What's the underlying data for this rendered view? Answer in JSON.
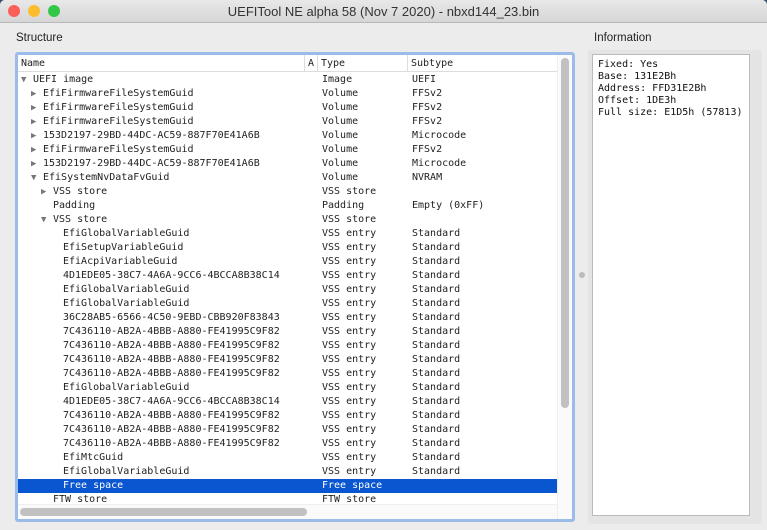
{
  "window": {
    "title": "UEFITool NE alpha 58 (Nov  7 2020) - nbxd144_23.bin"
  },
  "structure": {
    "label": "Structure",
    "columns": [
      "Name",
      "A",
      "Type",
      "Subtype"
    ],
    "rows": [
      {
        "name": "UEFI image",
        "type": "Image",
        "subtype": "UEFI",
        "depth": 0,
        "state": "expanded"
      },
      {
        "name": "EfiFirmwareFileSystemGuid",
        "type": "Volume",
        "subtype": "FFSv2",
        "depth": 1,
        "state": "collapsed"
      },
      {
        "name": "EfiFirmwareFileSystemGuid",
        "type": "Volume",
        "subtype": "FFSv2",
        "depth": 1,
        "state": "collapsed"
      },
      {
        "name": "EfiFirmwareFileSystemGuid",
        "type": "Volume",
        "subtype": "FFSv2",
        "depth": 1,
        "state": "collapsed"
      },
      {
        "name": "153D2197-29BD-44DC-AC59-887F70E41A6B",
        "type": "Volume",
        "subtype": "Microcode",
        "depth": 1,
        "state": "collapsed"
      },
      {
        "name": "EfiFirmwareFileSystemGuid",
        "type": "Volume",
        "subtype": "FFSv2",
        "depth": 1,
        "state": "collapsed"
      },
      {
        "name": "153D2197-29BD-44DC-AC59-887F70E41A6B",
        "type": "Volume",
        "subtype": "Microcode",
        "depth": 1,
        "state": "collapsed"
      },
      {
        "name": "EfiSystemNvDataFvGuid",
        "type": "Volume",
        "subtype": "NVRAM",
        "depth": 1,
        "state": "expanded"
      },
      {
        "name": "VSS store",
        "type": "VSS store",
        "subtype": "",
        "depth": 2,
        "state": "collapsed"
      },
      {
        "name": "Padding",
        "type": "Padding",
        "subtype": "Empty (0xFF)",
        "depth": 2,
        "state": "none"
      },
      {
        "name": "VSS store",
        "type": "VSS store",
        "subtype": "",
        "depth": 2,
        "state": "expanded"
      },
      {
        "name": "EfiGlobalVariableGuid",
        "type": "VSS entry",
        "subtype": "Standard",
        "depth": 3,
        "state": "none"
      },
      {
        "name": "EfiSetupVariableGuid",
        "type": "VSS entry",
        "subtype": "Standard",
        "depth": 3,
        "state": "none"
      },
      {
        "name": "EfiAcpiVariableGuid",
        "type": "VSS entry",
        "subtype": "Standard",
        "depth": 3,
        "state": "none"
      },
      {
        "name": "4D1EDE05-38C7-4A6A-9CC6-4BCCA8B38C14",
        "type": "VSS entry",
        "subtype": "Standard",
        "depth": 3,
        "state": "none"
      },
      {
        "name": "EfiGlobalVariableGuid",
        "type": "VSS entry",
        "subtype": "Standard",
        "depth": 3,
        "state": "none"
      },
      {
        "name": "EfiGlobalVariableGuid",
        "type": "VSS entry",
        "subtype": "Standard",
        "depth": 3,
        "state": "none"
      },
      {
        "name": "36C28AB5-6566-4C50-9EBD-CBB920F83843",
        "type": "VSS entry",
        "subtype": "Standard",
        "depth": 3,
        "state": "none"
      },
      {
        "name": "7C436110-AB2A-4BBB-A880-FE41995C9F82",
        "type": "VSS entry",
        "subtype": "Standard",
        "depth": 3,
        "state": "none"
      },
      {
        "name": "7C436110-AB2A-4BBB-A880-FE41995C9F82",
        "type": "VSS entry",
        "subtype": "Standard",
        "depth": 3,
        "state": "none"
      },
      {
        "name": "7C436110-AB2A-4BBB-A880-FE41995C9F82",
        "type": "VSS entry",
        "subtype": "Standard",
        "depth": 3,
        "state": "none"
      },
      {
        "name": "7C436110-AB2A-4BBB-A880-FE41995C9F82",
        "type": "VSS entry",
        "subtype": "Standard",
        "depth": 3,
        "state": "none"
      },
      {
        "name": "EfiGlobalVariableGuid",
        "type": "VSS entry",
        "subtype": "Standard",
        "depth": 3,
        "state": "none"
      },
      {
        "name": "4D1EDE05-38C7-4A6A-9CC6-4BCCA8B38C14",
        "type": "VSS entry",
        "subtype": "Standard",
        "depth": 3,
        "state": "none"
      },
      {
        "name": "7C436110-AB2A-4BBB-A880-FE41995C9F82",
        "type": "VSS entry",
        "subtype": "Standard",
        "depth": 3,
        "state": "none"
      },
      {
        "name": "7C436110-AB2A-4BBB-A880-FE41995C9F82",
        "type": "VSS entry",
        "subtype": "Standard",
        "depth": 3,
        "state": "none"
      },
      {
        "name": "7C436110-AB2A-4BBB-A880-FE41995C9F82",
        "type": "VSS entry",
        "subtype": "Standard",
        "depth": 3,
        "state": "none"
      },
      {
        "name": "EfiMtcGuid",
        "type": "VSS entry",
        "subtype": "Standard",
        "depth": 3,
        "state": "none"
      },
      {
        "name": "EfiGlobalVariableGuid",
        "type": "VSS entry",
        "subtype": "Standard",
        "depth": 3,
        "state": "none"
      },
      {
        "name": "Free space",
        "type": "Free space",
        "subtype": "",
        "depth": 3,
        "state": "none",
        "selected": true
      },
      {
        "name": "FTW store",
        "type": "FTW store",
        "subtype": "",
        "depth": 2,
        "state": "none"
      }
    ]
  },
  "information": {
    "label": "Information",
    "lines": [
      "Fixed: Yes",
      "Base: 131E2Bh",
      "Address: FFD31E2Bh",
      "Offset: 1DE3h",
      "Full size: E1D5h (57813)"
    ]
  },
  "colors": {
    "selection": "#0a55d0",
    "close": "#fc5f57",
    "minimize": "#fdbc2e",
    "maximize": "#33c748"
  }
}
